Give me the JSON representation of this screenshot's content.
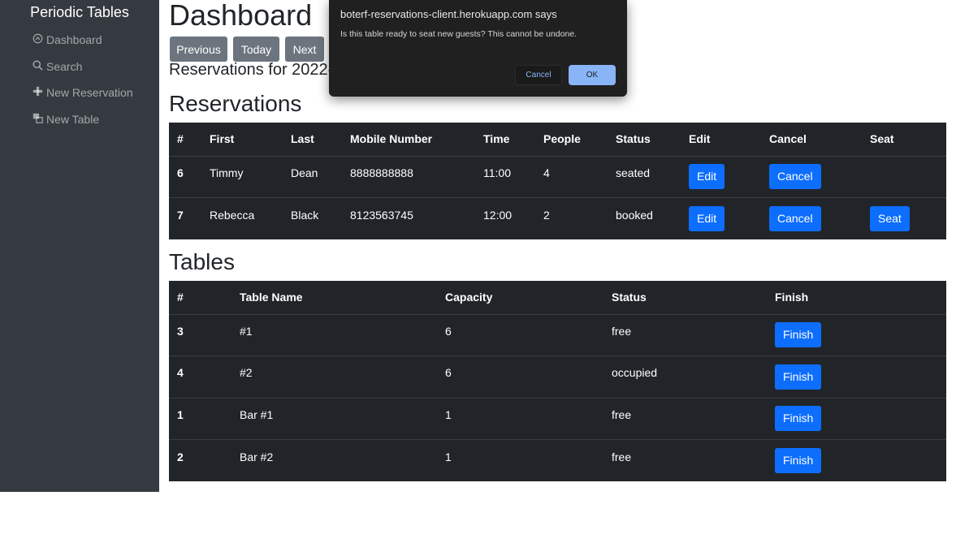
{
  "sidebar": {
    "brand": "Periodic Tables",
    "items": [
      {
        "label": "Dashboard",
        "icon": "dashboard-icon"
      },
      {
        "label": "Search",
        "icon": "search-icon"
      },
      {
        "label": "New Reservation",
        "icon": "plus-icon"
      },
      {
        "label": "New Table",
        "icon": "table-icon"
      }
    ]
  },
  "main": {
    "title": "Dashboard",
    "nav_buttons": {
      "previous": "Previous",
      "today": "Today",
      "next": "Next"
    },
    "reservations_for": "Reservations for 2022-",
    "reservations_heading": "Reservations",
    "tables_heading": "Tables"
  },
  "reservations": {
    "headers": [
      "#",
      "First",
      "Last",
      "Mobile Number",
      "Time",
      "People",
      "Status",
      "Edit",
      "Cancel",
      "Seat"
    ],
    "rows": [
      {
        "id": "6",
        "first": "Timmy",
        "last": "Dean",
        "mobile": "8888888888",
        "time": "11:00",
        "people": "4",
        "status": "seated",
        "edit": "Edit",
        "cancel": "Cancel",
        "seat": ""
      },
      {
        "id": "7",
        "first": "Rebecca",
        "last": "Black",
        "mobile": "8123563745",
        "time": "12:00",
        "people": "2",
        "status": "booked",
        "edit": "Edit",
        "cancel": "Cancel",
        "seat": "Seat"
      }
    ]
  },
  "tables": {
    "headers": [
      "#",
      "Table Name",
      "Capacity",
      "Status",
      "Finish"
    ],
    "rows": [
      {
        "id": "3",
        "name": "#1",
        "capacity": "6",
        "status": "free",
        "finish": "Finish"
      },
      {
        "id": "4",
        "name": "#2",
        "capacity": "6",
        "status": "occupied",
        "finish": "Finish"
      },
      {
        "id": "1",
        "name": "Bar #1",
        "capacity": "1",
        "status": "free",
        "finish": "Finish"
      },
      {
        "id": "2",
        "name": "Bar #2",
        "capacity": "1",
        "status": "free",
        "finish": "Finish"
      }
    ]
  },
  "dialog": {
    "title": "boterf-reservations-client.herokuapp.com says",
    "message": "Is this table ready to seat new guests? This cannot be undone.",
    "cancel": "Cancel",
    "ok": "OK"
  },
  "colors": {
    "sidebar_bg": "#343a40",
    "table_bg": "#212529",
    "primary": "#0d6efd",
    "secondary": "#6c757d",
    "dialog_bg": "#202020",
    "dialog_accent": "#8ab4f8"
  }
}
